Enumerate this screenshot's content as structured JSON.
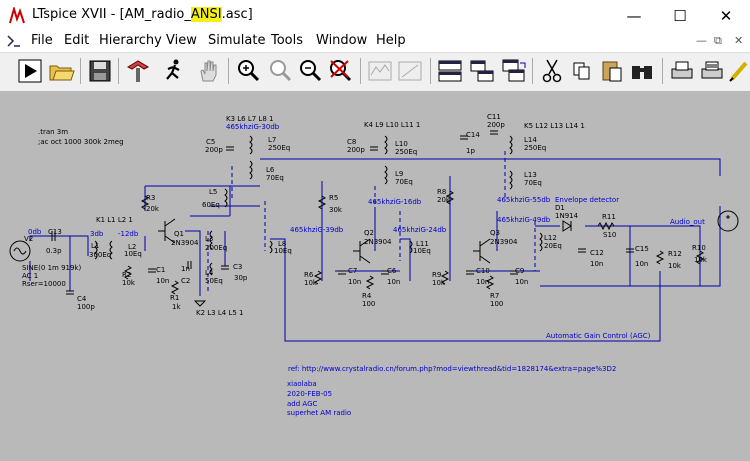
{
  "window": {
    "title_prefix": "LTspice XVII - [AM_radio_",
    "title_highlight": "ANSI",
    "title_suffix": ".asc]",
    "controls": [
      "—",
      "☐",
      "✕"
    ]
  },
  "menu": {
    "items": [
      "File",
      "Edit",
      "Hierarchy",
      "View",
      "Simulate",
      "Tools",
      "Window",
      "Help"
    ],
    "mdi_controls": [
      "—",
      "⧉",
      "✕"
    ]
  },
  "toolbar": {
    "buttons": [
      "run-icon",
      "open-icon",
      "save-icon",
      "control-panel-icon",
      "run-man-icon",
      "hand-icon",
      "zoom-in-icon",
      "zoom-pan-icon",
      "zoom-out-icon",
      "zoom-fit-icon",
      "plot-icon",
      "autoscale-icon",
      "tile-h-icon",
      "tile-v-icon",
      "cascade-icon",
      "cut-icon",
      "copy-icon",
      "paste-icon",
      "find-icon",
      "print-icon",
      "print-setup-icon",
      "pen-icon"
    ]
  },
  "schematic": {
    "directives": [
      ".tran 3m",
      ";ac oct 1000 300k 2meg"
    ],
    "components": [
      {
        "id": "V2",
        "label": "V2"
      },
      {
        "id": "V2_param",
        "label": "SINE(0 1m 919k)"
      },
      {
        "id": "V2_ac",
        "label": "AC 1"
      },
      {
        "id": "V2_rser",
        "label": "Rser=10000"
      },
      {
        "id": "C13",
        "label": "C13"
      },
      {
        "id": "C13v",
        "label": "0.3p"
      },
      {
        "id": "C4",
        "label": "C4"
      },
      {
        "id": "C4v",
        "label": "100p"
      },
      {
        "id": "L1",
        "label": "L1"
      },
      {
        "id": "L1v",
        "label": "300Eq"
      },
      {
        "id": "K1",
        "label": "K1 L1 L2 1"
      },
      {
        "id": "L2",
        "label": "L2"
      },
      {
        "id": "L2v",
        "label": "10Eq"
      },
      {
        "id": "R2",
        "label": "R2"
      },
      {
        "id": "R2v",
        "label": "10k"
      },
      {
        "id": "R3",
        "label": "R3"
      },
      {
        "id": "R3v",
        "label": "20k"
      },
      {
        "id": "C1",
        "label": "C1"
      },
      {
        "id": "C1v",
        "label": "10n"
      },
      {
        "id": "Q1",
        "label": "Q1"
      },
      {
        "id": "Q1v",
        "label": "2N3904"
      },
      {
        "id": "R1",
        "label": "R1"
      },
      {
        "id": "R1v",
        "label": "1k"
      },
      {
        "id": "C2",
        "label": "C2"
      },
      {
        "id": "C2v",
        "label": "1n"
      },
      {
        "id": "L3",
        "label": "L3"
      },
      {
        "id": "L3v",
        "label": "200Eq"
      },
      {
        "id": "L4",
        "label": "L4"
      },
      {
        "id": "L4v",
        "label": "50Eq"
      },
      {
        "id": "K2",
        "label": "K2 L3 L4 L5 1"
      },
      {
        "id": "C3",
        "label": "C3"
      },
      {
        "id": "C3v",
        "label": "30p"
      },
      {
        "id": "K3",
        "label": "K3 L6 L7 L8 1"
      },
      {
        "id": "C5",
        "label": "C5"
      },
      {
        "id": "C5v",
        "label": "200p"
      },
      {
        "id": "L7",
        "label": "L7"
      },
      {
        "id": "L7v",
        "label": "250Eq"
      },
      {
        "id": "L6",
        "label": "L6"
      },
      {
        "id": "L6v",
        "label": "70Eq"
      },
      {
        "id": "L5",
        "label": "L5"
      },
      {
        "id": "L5v",
        "label": "60Eq"
      },
      {
        "id": "L8",
        "label": "L8"
      },
      {
        "id": "L8v",
        "label": "10Eq"
      },
      {
        "id": "R5",
        "label": "R5"
      },
      {
        "id": "R5v",
        "label": "30k"
      },
      {
        "id": "R6",
        "label": "R6"
      },
      {
        "id": "R6v",
        "label": "10k"
      },
      {
        "id": "C7",
        "label": "C7"
      },
      {
        "id": "C7v",
        "label": "10n"
      },
      {
        "id": "Q2",
        "label": "Q2"
      },
      {
        "id": "Q2v",
        "label": "2N3904"
      },
      {
        "id": "R4",
        "label": "R4"
      },
      {
        "id": "R4v",
        "label": "100"
      },
      {
        "id": "C6",
        "label": "C6"
      },
      {
        "id": "C6v",
        "label": "10n"
      },
      {
        "id": "K4",
        "label": "K4 L9 L10 L11 1"
      },
      {
        "id": "C8",
        "label": "C8"
      },
      {
        "id": "C8v",
        "label": "200p"
      },
      {
        "id": "L10",
        "label": "L10"
      },
      {
        "id": "L10v",
        "label": "250Eq"
      },
      {
        "id": "L9",
        "label": "L9"
      },
      {
        "id": "L9v",
        "label": "70Eq"
      },
      {
        "id": "L11",
        "label": "L11"
      },
      {
        "id": "L11v",
        "label": "10Eq"
      },
      {
        "id": "R8",
        "label": "R8"
      },
      {
        "id": "R8v",
        "label": "20k"
      },
      {
        "id": "R9",
        "label": "R9"
      },
      {
        "id": "R9v",
        "label": "10k"
      },
      {
        "id": "C10",
        "label": "C10"
      },
      {
        "id": "C10v",
        "label": "10n"
      },
      {
        "id": "Q3",
        "label": "Q3"
      },
      {
        "id": "Q3v",
        "label": "2N3904"
      },
      {
        "id": "R7",
        "label": "R7"
      },
      {
        "id": "R7v",
        "label": "100"
      },
      {
        "id": "C9",
        "label": "C9"
      },
      {
        "id": "C9v",
        "label": "10n"
      },
      {
        "id": "C14",
        "label": "C14"
      },
      {
        "id": "C14v",
        "label": "1p"
      },
      {
        "id": "C11",
        "label": "C11"
      },
      {
        "id": "C11v",
        "label": "200p"
      },
      {
        "id": "K5",
        "label": "K5  L12 L13 L14 1"
      },
      {
        "id": "L14",
        "label": "L14"
      },
      {
        "id": "L14v",
        "label": "250Eq"
      },
      {
        "id": "L13",
        "label": "L13"
      },
      {
        "id": "L13v",
        "label": "70Eq"
      },
      {
        "id": "L12",
        "label": "L12"
      },
      {
        "id": "L12v",
        "label": "20Eq"
      },
      {
        "id": "D1",
        "label": "D1"
      },
      {
        "id": "D1v",
        "label": "1N914"
      },
      {
        "id": "R11",
        "label": "R11"
      },
      {
        "id": "R11v",
        "label": "S10"
      },
      {
        "id": "C12",
        "label": "C12"
      },
      {
        "id": "C12v",
        "label": "10n"
      },
      {
        "id": "C15",
        "label": "C15"
      },
      {
        "id": "C15v",
        "label": "10n"
      },
      {
        "id": "R12",
        "label": "R12"
      },
      {
        "id": "R12v",
        "label": "10k"
      },
      {
        "id": "R10",
        "label": "R10"
      },
      {
        "id": "R10v",
        "label": "10k"
      },
      {
        "id": "V1",
        "label": "V1"
      },
      {
        "id": "V1v",
        "label": "4"
      }
    ],
    "net_labels": [
      {
        "id": "n0db",
        "label": "0db"
      },
      {
        "id": "n3db",
        "label": "3db"
      },
      {
        "id": "n12db",
        "label": "-12db"
      },
      {
        "id": "n30db",
        "label": "465khziG-30db"
      },
      {
        "id": "n39db",
        "label": "465khziG-39db"
      },
      {
        "id": "n16db",
        "label": "465khziG-16db"
      },
      {
        "id": "n24db",
        "label": "465khziG-24db"
      },
      {
        "id": "n55db",
        "label": "465khziG-55db"
      },
      {
        "id": "n49db",
        "label": "465khziG-49db"
      },
      {
        "id": "envdet",
        "label": "Envelope detector"
      },
      {
        "id": "audio",
        "label": "Audio_out"
      },
      {
        "id": "agc",
        "label": "Automatic Gain Control (AGC)"
      }
    ],
    "notes": [
      "ref: http://www.crystalradio.cn/forum.php?mod=viewthread&tid=1828174&extra=page%3D2",
      "xiaolaba",
      "2020-FEB-05",
      "add AGC",
      "superhet AM radio"
    ]
  }
}
